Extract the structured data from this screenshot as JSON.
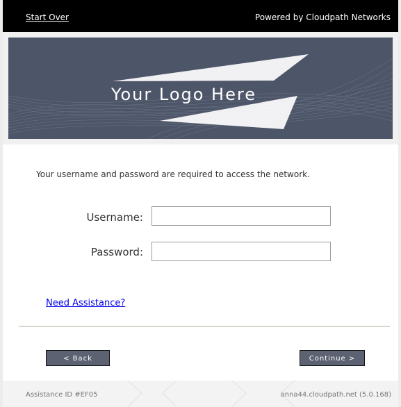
{
  "topbar": {
    "start_over": "Start Over",
    "powered_by": "Powered by Cloudpath Networks"
  },
  "banner": {
    "logo_text": "Your Logo Here"
  },
  "form": {
    "instructions": "Your username and password are required to access the network.",
    "username_label": "Username:",
    "password_label": "Password:",
    "username_value": "",
    "password_value": "",
    "assistance_link": "Need Assistance?"
  },
  "buttons": {
    "back": "< Back",
    "continue": "Continue >"
  },
  "footer": {
    "assistance_id": "Assistance ID #EF05",
    "host": "anna44.cloudpath.net (5.0.168)"
  },
  "colors": {
    "topbar_bg": "#000000",
    "banner_bg": "#4d5568",
    "button_bg": "#5d6273",
    "link": "#0000ee"
  }
}
